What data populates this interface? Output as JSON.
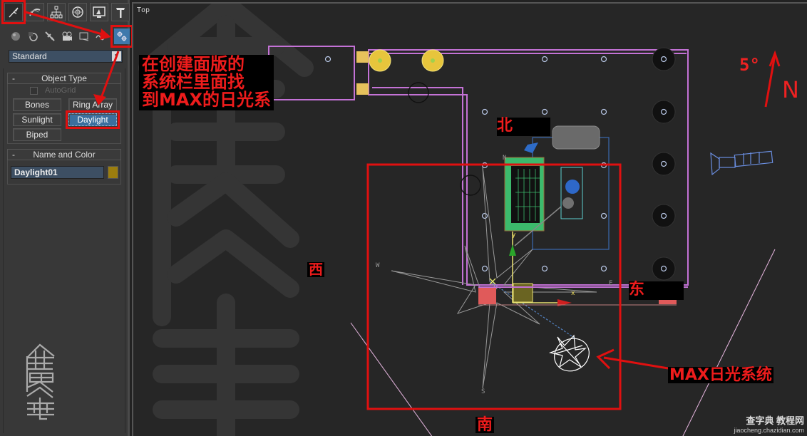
{
  "command_panel": {
    "tabs": [
      {
        "name": "create",
        "icon": "create-icon",
        "active": true
      },
      {
        "name": "modify",
        "icon": "modify-icon",
        "active": false
      },
      {
        "name": "hierarchy",
        "icon": "hierarchy-icon",
        "active": false
      },
      {
        "name": "motion",
        "icon": "motion-icon",
        "active": false
      },
      {
        "name": "display",
        "icon": "display-icon",
        "active": false
      },
      {
        "name": "utilities",
        "icon": "utilities-icon",
        "active": false
      }
    ],
    "categories": [
      {
        "name": "geometry",
        "icon": "geometry-icon"
      },
      {
        "name": "shapes",
        "icon": "shapes-icon"
      },
      {
        "name": "lights",
        "icon": "lights-icon"
      },
      {
        "name": "cameras",
        "icon": "cameras-icon"
      },
      {
        "name": "helpers",
        "icon": "helpers-icon"
      },
      {
        "name": "space-warps",
        "icon": "space-warps-icon"
      },
      {
        "name": "systems",
        "icon": "systems-icon",
        "active": true
      }
    ],
    "dropdown_value": "Standard",
    "object_type": {
      "title": "Object Type",
      "collapse_symbol": "-",
      "autogrid_label": "AutoGrid",
      "autogrid_checked": false,
      "buttons": [
        "Bones",
        "Ring Array",
        "Sunlight",
        "Daylight",
        "Biped"
      ],
      "selected": "Daylight"
    },
    "name_and_color": {
      "title": "Name and Color",
      "collapse_symbol": "-",
      "name_value": "Daylight01",
      "color": "#9b7d0e"
    }
  },
  "viewport": {
    "label": "Top",
    "annotations": {
      "instruction_lines": [
        "在创建面版的",
        "系统栏里面找",
        "到MAX的日光系"
      ],
      "north": "北",
      "west": "西",
      "east": "东",
      "south": "南",
      "daylight_system": "MAX日光系统",
      "angle": "5°",
      "north_letter": "N"
    },
    "axis_labels": {
      "x": "x",
      "y": "y"
    },
    "compass_labels": {
      "w": "W",
      "s": "S",
      "e": "E",
      "n": "N"
    },
    "accent_color": "#ee1c1c"
  },
  "watermark": {
    "title": "查字典 教程网",
    "url": "jiaocheng.chazidian.com"
  }
}
